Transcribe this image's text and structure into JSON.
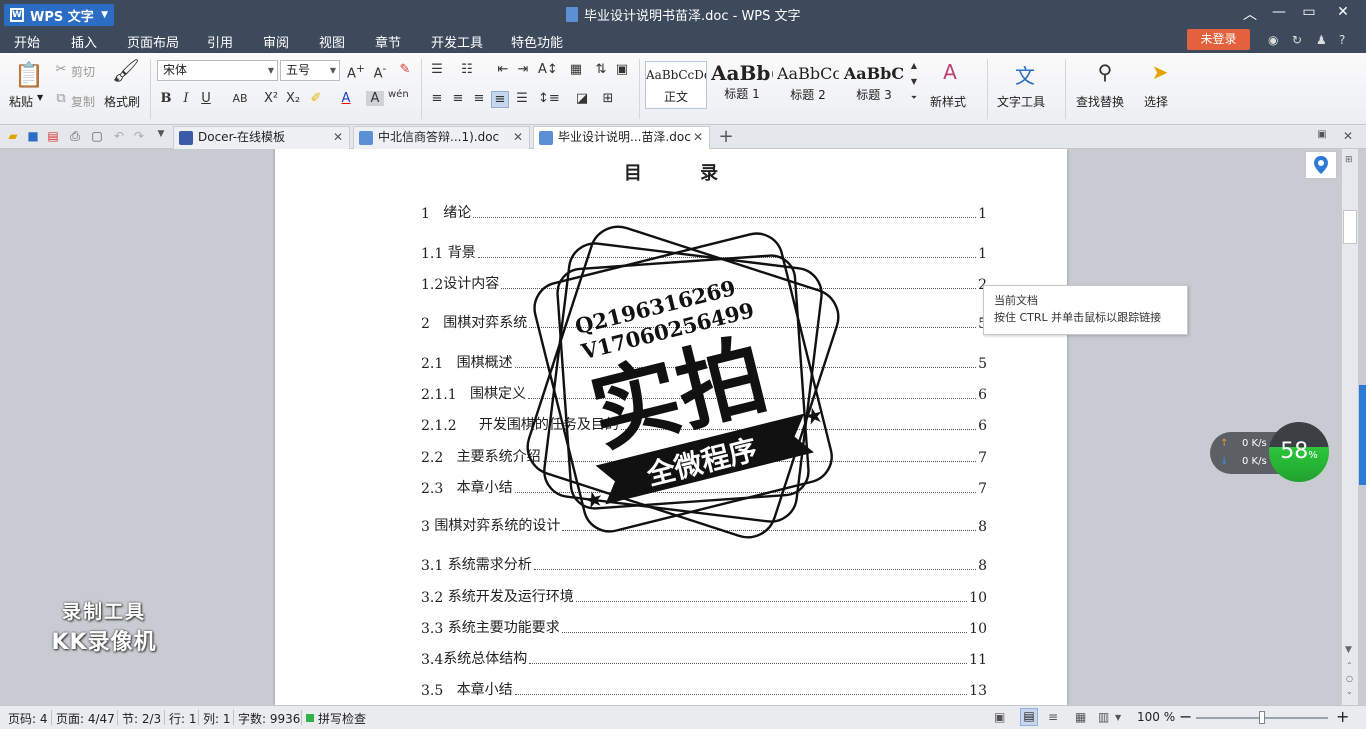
{
  "titlebar": {
    "app_name": "WPS 文字",
    "doc_title": "毕业设计说明书苗泽.doc - WPS 文字"
  },
  "menu": {
    "tabs": [
      "开始",
      "插入",
      "页面布局",
      "引用",
      "审阅",
      "视图",
      "章节",
      "开发工具",
      "特色功能"
    ],
    "active": "开始",
    "login": "未登录"
  },
  "ribbon": {
    "paste": "粘贴",
    "cut": "剪切",
    "copy": "复制",
    "format_painter": "格式刷",
    "font_name": "宋体",
    "font_size": "五号",
    "styles": [
      {
        "sample": "AaBbCcDd",
        "name": "正文"
      },
      {
        "sample": "AaBb(",
        "name": "标题 1"
      },
      {
        "sample": "AaBbCc",
        "name": "标题 2"
      },
      {
        "sample": "AaBbC",
        "name": "标题 3"
      }
    ],
    "new_style": "新样式",
    "text_tools": "文字工具",
    "find_replace": "查找替换",
    "select": "选择"
  },
  "doc_tabs": [
    {
      "label": "Docer-在线模板"
    },
    {
      "label": "中北信商答辩...1).doc"
    },
    {
      "label": "毕业设计说明...苗泽.doc",
      "active": true
    }
  ],
  "toc": {
    "title": "目 录",
    "entries": [
      {
        "num": "1",
        "gap": "   ",
        "text": "绪论",
        "page": "1"
      },
      {
        "num": "1.1",
        "gap": " ",
        "text": "背景",
        "page": "1"
      },
      {
        "num": "1.2",
        "gap": "",
        "text": "设计内容",
        "page": "2"
      },
      {
        "num": "2",
        "gap": "   ",
        "text": "围棋对弈系统",
        "page": "5"
      },
      {
        "num": "2.1",
        "gap": "   ",
        "text": "围棋概述",
        "page": "5"
      },
      {
        "num": "2.1.1",
        "gap": "   ",
        "text": "围棋定义",
        "page": "6"
      },
      {
        "num": "2.1.2",
        "gap": "     ",
        "text": "开发围棋的任务及目的",
        "page": "6"
      },
      {
        "num": "2.2",
        "gap": "   ",
        "text": "主要系统介绍",
        "page": "7"
      },
      {
        "num": "2.3",
        "gap": "   ",
        "text": "本章小结",
        "page": "7"
      },
      {
        "num": "3",
        "gap": " ",
        "text": "围棋对弈系统的设计",
        "page": "8"
      },
      {
        "num": "3.1",
        "gap": " ",
        "text": "系统需求分析",
        "page": "8"
      },
      {
        "num": "3.2",
        "gap": " ",
        "text": "系统开发及运行环境",
        "page": "10"
      },
      {
        "num": "3.3",
        "gap": " ",
        "text": "系统主要功能要求",
        "page": "10"
      },
      {
        "num": "3.4",
        "gap": "",
        "text": "系统总体结构",
        "page": "11"
      },
      {
        "num": "3.5",
        "gap": "   ",
        "text": "本章小结",
        "page": "13"
      }
    ]
  },
  "stamp": {
    "contact1": "Q2196316269",
    "contact2": "V17060256499",
    "big": "实拍",
    "banner": "全微程序"
  },
  "tooltip": {
    "line1": "当前文档",
    "line2": "按住 CTRL 并单击鼠标以跟踪链接"
  },
  "network": {
    "up": "0 K/s",
    "down": "0 K/s",
    "percent": "58",
    "percent_unit": "%"
  },
  "watermark": {
    "line1": "录制工具",
    "line2": "KK录像机"
  },
  "status": {
    "page_code": "页码: 4",
    "page": "页面: 4/47",
    "section": "节: 2/3",
    "row": "行: 1",
    "col": "列: 1",
    "words": "字数: 9936",
    "spell": "拼写检查",
    "zoom": "100 %",
    "zoom_level": 0.5
  }
}
